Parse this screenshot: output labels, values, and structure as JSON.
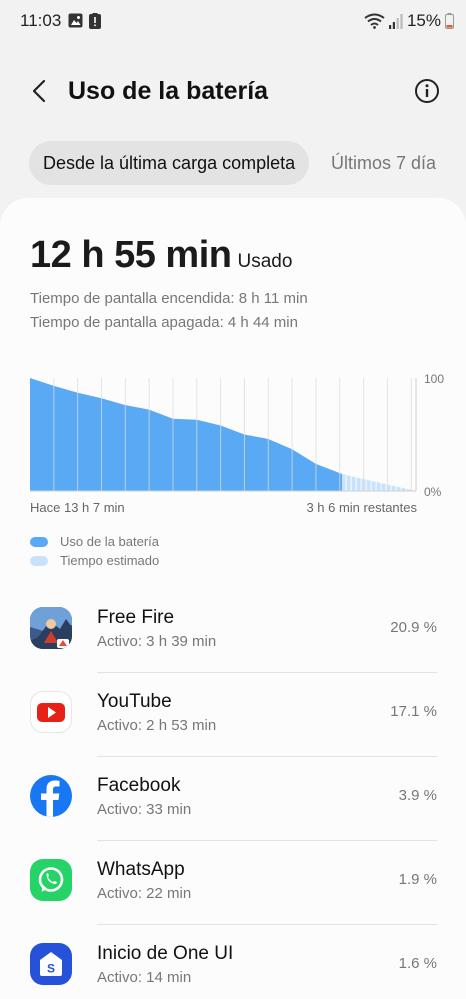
{
  "status_bar": {
    "time": "11:03",
    "battery_percent": "15%"
  },
  "header": {
    "title": "Uso de la batería"
  },
  "tabs": [
    {
      "label": "Desde la última carga completa",
      "selected": true
    },
    {
      "label": "Últimos 7 día",
      "selected": false
    }
  ],
  "summary": {
    "used_value": "12 h 55 min",
    "used_label": "Usado",
    "screen_on": "Tiempo de pantalla encendida: 8 h 11 min",
    "screen_off": "Tiempo de pantalla apagada: 4 h 44 min"
  },
  "chart_data": {
    "type": "area",
    "x_start_label": "Hace 13 h 7 min",
    "x_end_label": "3 h 6 min restantes",
    "y_top_label": "100",
    "y_bottom_label": "0%",
    "ylim": [
      0,
      100
    ],
    "x_hours": [
      0,
      1,
      2,
      3,
      4,
      5,
      6,
      7,
      8,
      9,
      10,
      11,
      12,
      13.1
    ],
    "usage_percent": [
      100,
      93,
      87,
      82,
      76,
      72,
      64,
      63,
      58,
      50,
      46,
      37,
      24,
      15
    ],
    "estimated_hours": [
      13.1,
      16.2
    ],
    "estimated_percent": [
      15,
      0
    ],
    "colors": {
      "usage": "#5aa9f5",
      "estimated": "#c9e2fb"
    }
  },
  "legend": {
    "usage_label": "Uso de la batería",
    "estimated_label": "Tiempo estimado"
  },
  "apps": [
    {
      "name": "Free Fire",
      "active": "Activo: 3 h 39 min",
      "percent": "20.9 %",
      "icon": "free-fire-icon"
    },
    {
      "name": "YouTube",
      "active": "Activo: 2 h 53 min",
      "percent": "17.1 %",
      "icon": "youtube-icon"
    },
    {
      "name": "Facebook",
      "active": "Activo: 33 min",
      "percent": "3.9 %",
      "icon": "facebook-icon"
    },
    {
      "name": "WhatsApp",
      "active": "Activo: 22 min",
      "percent": "1.9 %",
      "icon": "whatsapp-icon"
    },
    {
      "name": "Inicio de One UI",
      "active": "Activo: 14 min",
      "percent": "1.6 %",
      "icon": "one-ui-home-icon"
    }
  ]
}
